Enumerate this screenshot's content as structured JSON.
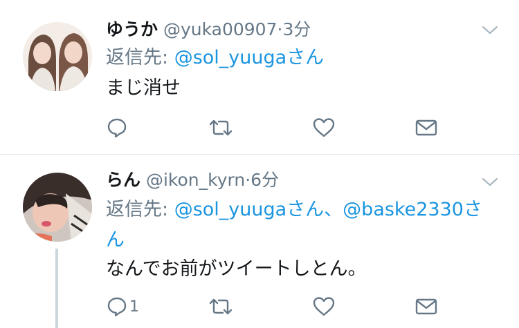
{
  "tweets": [
    {
      "name": "ゆうか",
      "handle": "@yuka00907",
      "separator": "·",
      "time": "3分",
      "reply_prefix": "返信先:",
      "reply_mentions": "@sol_yuugaさん",
      "text": "まじ消せ",
      "avatar_icon": "avatar-photo-two-girls",
      "reply_count": ""
    },
    {
      "name": "らん",
      "handle": "@ikon_kyrn",
      "separator": "·",
      "time": "6分",
      "reply_prefix": "返信先:",
      "reply_mentions": "@sol_yuugaさん、@baske2330さん",
      "text": "なんでお前がツイートしとん。",
      "avatar_icon": "avatar-photo-girl-selfie",
      "reply_count": "1"
    }
  ],
  "icons": [
    "reply-icon",
    "retweet-icon",
    "like-icon",
    "dm-icon",
    "chevron-down-icon"
  ],
  "colors": {
    "link": "#1b95e0",
    "muted": "#657786",
    "text": "#14171a",
    "divider": "#e1e8ed"
  }
}
